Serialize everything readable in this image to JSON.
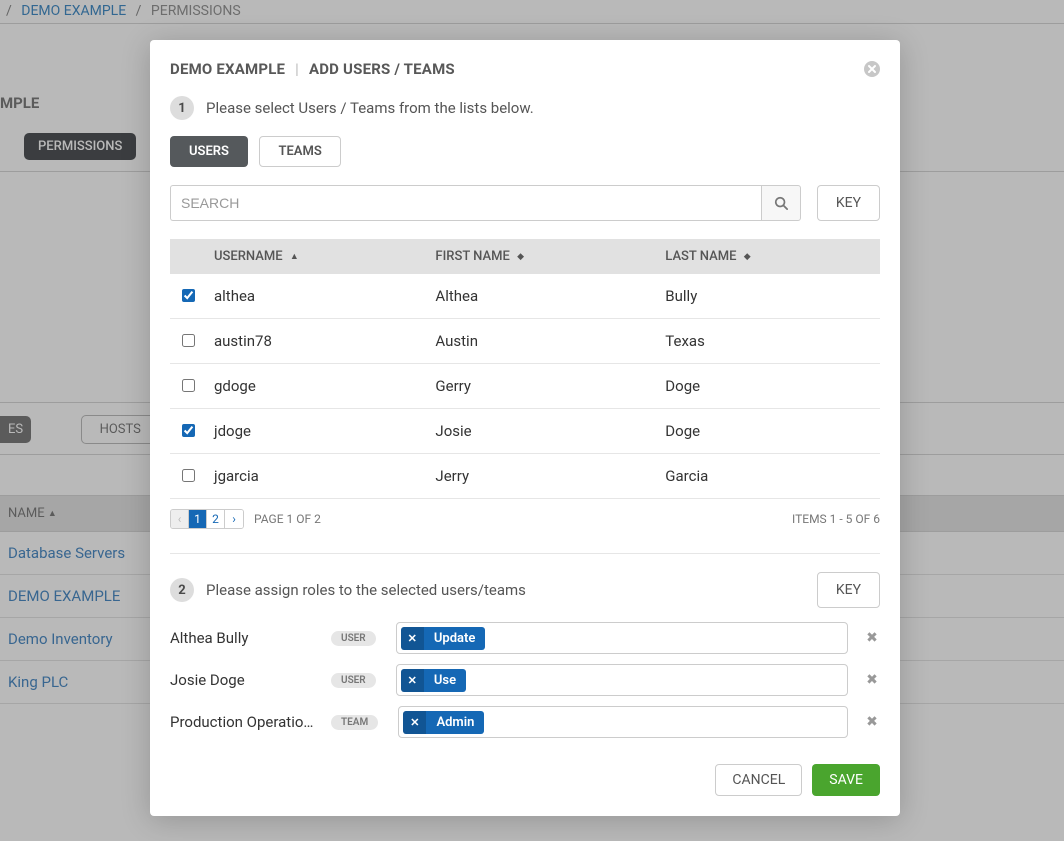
{
  "breadcrumb": {
    "link_label": "DEMO EXAMPLE",
    "current": "PERMISSIONS"
  },
  "bg": {
    "title_fragment": "MPLE",
    "tab_permissions": "PERMISSIONS",
    "tab_es": "ES",
    "hosts_button": "HOSTS",
    "name_header": "NAME",
    "list_items": [
      "Database Servers",
      "DEMO EXAMPLE",
      "Demo Inventory",
      "King PLC"
    ]
  },
  "modal": {
    "title_context": "DEMO EXAMPLE",
    "title_action": "ADD USERS / TEAMS",
    "step1_text": "Please select Users / Teams from the lists below.",
    "step2_text": "Please assign roles to the selected users/teams",
    "tabs": {
      "users": "USERS",
      "teams": "TEAMS"
    },
    "search_placeholder": "SEARCH",
    "key_button": "KEY",
    "columns": {
      "username": "USERNAME",
      "first": "FIRST NAME",
      "last": "LAST NAME"
    },
    "users": [
      {
        "checked": true,
        "username": "althea",
        "first": "Althea",
        "last": "Bully"
      },
      {
        "checked": false,
        "username": "austin78",
        "first": "Austin",
        "last": "Texas"
      },
      {
        "checked": false,
        "username": "gdoge",
        "first": "Gerry",
        "last": "Doge"
      },
      {
        "checked": true,
        "username": "jdoge",
        "first": "Josie",
        "last": "Doge"
      },
      {
        "checked": false,
        "username": "jgarcia",
        "first": "Jerry",
        "last": "Garcia"
      }
    ],
    "pager": {
      "pages": [
        "1",
        "2"
      ],
      "active_index": 0,
      "page_text": "PAGE 1 OF 2",
      "items_text": "ITEMS  1 - 5 OF 6"
    },
    "assignments": [
      {
        "name": "Althea Bully",
        "type": "USER",
        "role": "Update"
      },
      {
        "name": "Josie Doge",
        "type": "USER",
        "role": "Use"
      },
      {
        "name": "Production Operatio…",
        "type": "TEAM",
        "role": "Admin"
      }
    ],
    "actions": {
      "cancel": "CANCEL",
      "save": "SAVE"
    }
  }
}
